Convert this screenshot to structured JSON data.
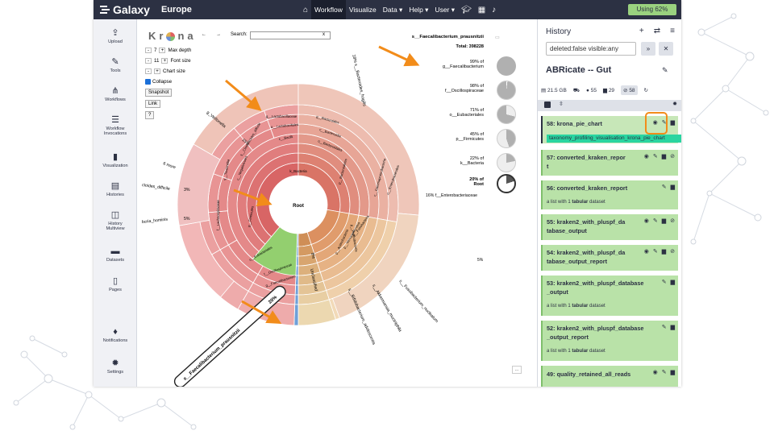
{
  "brand": {
    "name": "Galaxy",
    "subtitle": "Europe"
  },
  "nav": {
    "home_icon": "home-icon",
    "items": [
      {
        "label": "Workflow",
        "active": true
      },
      {
        "label": "Visualize"
      },
      {
        "label": "Data ▾"
      },
      {
        "label": "Help ▾"
      },
      {
        "label": "User ▾"
      }
    ],
    "icons": [
      "graduation-cap-icon",
      "apps-grid-icon",
      "bell-icon"
    ],
    "usage": "Using 62%"
  },
  "activity": [
    {
      "label": "Upload",
      "icon": "upload-icon",
      "glyph": "⇪"
    },
    {
      "label": "Tools",
      "icon": "wrench-icon",
      "glyph": "✎"
    },
    {
      "label": "Workflows",
      "icon": "sitemap-icon",
      "glyph": "⋔"
    },
    {
      "label": "Workflow Invocations",
      "icon": "list-icon",
      "glyph": "☰"
    },
    {
      "label": "Visualization",
      "icon": "chart-icon",
      "glyph": "▮"
    },
    {
      "label": "Histories",
      "icon": "histories-icon",
      "glyph": "▤"
    },
    {
      "label": "History Multiview",
      "icon": "columns-icon",
      "glyph": "◫"
    },
    {
      "label": "Datasets",
      "icon": "folder-icon",
      "glyph": "▬"
    },
    {
      "label": "Pages",
      "icon": "file-icon",
      "glyph": "▯"
    },
    {
      "label": "Notifications",
      "icon": "bell-icon",
      "glyph": "♦"
    },
    {
      "label": "Settings",
      "icon": "gear-icon",
      "glyph": "✹"
    }
  ],
  "krona": {
    "logo_left": "Kr",
    "logo_right": "na",
    "back": "←",
    "forward": "→",
    "search_label": "Search:",
    "search_clear": "x",
    "max_depth": {
      "minus": "-",
      "value": "7",
      "plus": "+",
      "label": "Max depth"
    },
    "font_size": {
      "minus": "-",
      "value": "11",
      "plus": "+",
      "label": "Font size"
    },
    "chart_size": {
      "minus": "-",
      "plus": "+",
      "label": "Chart size"
    },
    "collapse_label": "Collapse",
    "snapshot_label": "Snapshot",
    "link_label": "Link",
    "help_label": "?",
    "selected_name": "s__Faecalibacterium_prausnitzii",
    "total": "Total: 398228",
    "summary": [
      {
        "pct": "99% of",
        "name": "g__Faecalibacterium"
      },
      {
        "pct": "98% of",
        "name": "f__Oscillospiraceae"
      },
      {
        "pct": "71% of",
        "name": "o__Eubacteriales"
      },
      {
        "pct": "45% of",
        "name": "p__Firmicutes"
      },
      {
        "pct": "22% of",
        "name": "k__Bacteria"
      },
      {
        "pct": "20% of",
        "name": "Root"
      }
    ],
    "root_label": "Root",
    "labels": {
      "bacteria": "k_Bacteria",
      "bacteroides_fragilis": "18% s__Bacteroides_fragilis",
      "veillonella": "g_Veillonella",
      "veillonella_pct": "15%",
      "six_more": "6 more",
      "difficile": "cloides_difficile",
      "difficile_pct": "3%",
      "hominis": "buria_hominis",
      "hominis_pct": "5%",
      "enterobacteriaceae": "16% f__Enterobacteriaceae",
      "fuso": "s__Fusobacterium_nucleatum",
      "akkermansia": "s__Akkermansia_muciniphila",
      "adolescentis": "s__Bifidobacterium_adolescentis",
      "unclassified": "Unclassified",
      "unclassified_pct": "8%",
      "faecali": "s__Faecalibacterium_prausnitzii",
      "faecali_pct": "20%",
      "lactobacillus": "g__Lactobacillaceae",
      "bacteroides_g": "g__Bacteroides",
      "firmicutes": "p__Firmicutes",
      "bacteroidetes": "p__Bacteroidetes",
      "proteobacteria": "p__Proteobacteria",
      "eubacteriales": "o__Eubacteriales",
      "oscillo": "f__Oscillospiraceae",
      "faecalibacterium": "g__Faecalibacterium",
      "negativicutes": "c__Negativicutes",
      "bacilli": "c__Bacilli",
      "lactobacillales": "o__Lactobacillales",
      "bacteroidia": "c__Bacteroidia",
      "bacteroidales": "o__Bacteroidales",
      "gamma": "c__Gammaproteobacteria",
      "entero_o": "o__Enterobacterales",
      "fuso_p": "p__Fusobacteria",
      "fuso_pct": "5%",
      "verruco": "p__Verrucomicrobia",
      "actino": "p__Actinobacteria",
      "clostri": "s__Clostridioides_difficile",
      "tissier": "s__Tissierellia",
      "lachno": "f__Lachnospiraceae"
    },
    "scroll_btn": "..."
  },
  "history": {
    "title": "History",
    "filter": "deleted:false visible:any",
    "name": "ABRicate -- Gut",
    "stats": {
      "size": "21.5 GB",
      "shown": "55",
      "deleted": "29",
      "hidden": "58"
    },
    "items": [
      {
        "title": "58: krona_pie_chart",
        "tag": "taxonomy_profiling_visualisation_krona_pie_chart",
        "active": true
      },
      {
        "title": "57: converted_kraken_repor",
        "title2": "t"
      },
      {
        "title": "56: converted_kraken_report",
        "sub_pre": "a list with 1 ",
        "sub_bold": "tabular",
        "sub_post": " dataset"
      },
      {
        "title": "55: kraken2_with_pluspf_da",
        "title2": "tabase_output"
      },
      {
        "title": "54: kraken2_with_pluspf_da",
        "title2": "tabase_output_report"
      },
      {
        "title": "53: kraken2_with_pluspf_database",
        "title2": "_output",
        "sub_pre": "a list with 1 ",
        "sub_bold": "tabular",
        "sub_post": " dataset"
      },
      {
        "title": "52: kraken2_with_pluspf_database",
        "title2": "_output_report",
        "sub_pre": "a list with 1 ",
        "sub_bold": "tabular",
        "sub_post": " dataset"
      },
      {
        "title": "49: quality_retained_all_reads"
      }
    ]
  },
  "colors": {
    "masthead": "#2c3143",
    "dataset_ok": "#b9e2a8",
    "highlight": "#f28c1a",
    "tag": "#2ad5a0"
  }
}
